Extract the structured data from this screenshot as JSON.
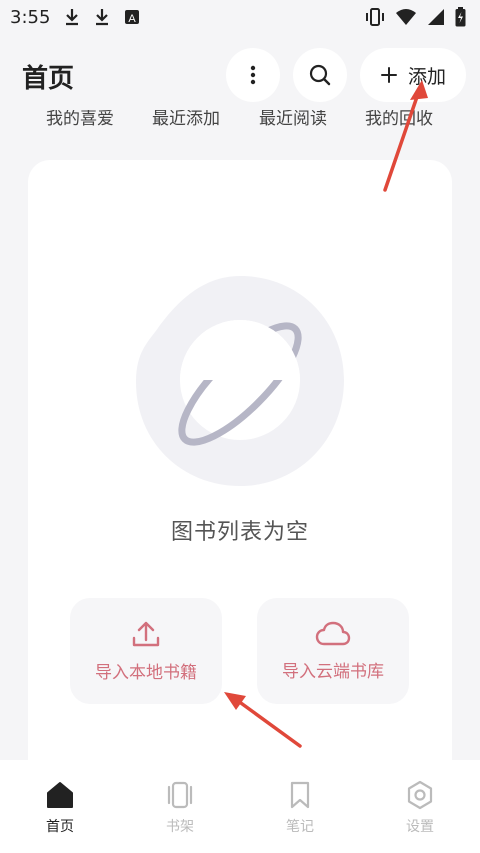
{
  "status": {
    "time": "3:55",
    "icons": [
      "download-icon",
      "download-icon",
      "font-app-icon"
    ],
    "right_icons": [
      "vibrate-icon",
      "wifi-icon",
      "signal-icon",
      "battery-icon"
    ]
  },
  "header": {
    "title": "首页",
    "add_label": "添加"
  },
  "tabs": [
    "我的喜爱",
    "最近添加",
    "最近阅读",
    "我的回收"
  ],
  "empty": {
    "message": "图书列表为空"
  },
  "actions": {
    "import_local": "导入本地书籍",
    "import_cloud": "导入云端书库"
  },
  "nav": [
    {
      "label": "首页",
      "icon": "home-icon",
      "active": true
    },
    {
      "label": "书架",
      "icon": "bookshelf-icon",
      "active": false
    },
    {
      "label": "笔记",
      "icon": "bookmark-icon",
      "active": false
    },
    {
      "label": "设置",
      "icon": "settings-icon",
      "active": false
    }
  ],
  "colors": {
    "accent": "#d2707d",
    "arrow": "#e0483a",
    "background": "#f5f5f7"
  }
}
